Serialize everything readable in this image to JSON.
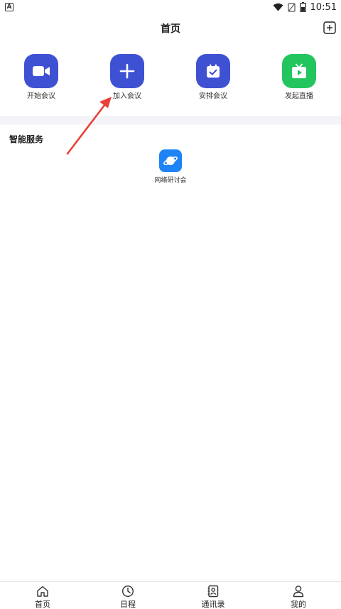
{
  "statusbar": {
    "app_badge": "A",
    "time": "10:51"
  },
  "header": {
    "title": "首页",
    "add_icon": "plus-square-icon"
  },
  "actions": [
    {
      "label": "开始会议",
      "icon": "video-camera-icon",
      "color": "#3f51d3"
    },
    {
      "label": "加入会议",
      "icon": "plus-icon",
      "color": "#3f51d3"
    },
    {
      "label": "安排会议",
      "icon": "calendar-check-icon",
      "color": "#3f51d3"
    },
    {
      "label": "发起直播",
      "icon": "live-tv-icon",
      "color": "#22c55e"
    }
  ],
  "services": {
    "title": "智能服务",
    "items": [
      {
        "label": "网络研讨会",
        "icon": "planet-icon",
        "color": "#1e84f5"
      }
    ]
  },
  "annotation": {
    "color": "#e8413a"
  },
  "tabbar": {
    "items": [
      {
        "label": "首页",
        "icon": "home-icon"
      },
      {
        "label": "日程",
        "icon": "clock-icon"
      },
      {
        "label": "通讯录",
        "icon": "contacts-icon"
      },
      {
        "label": "我的",
        "icon": "person-icon"
      }
    ]
  }
}
